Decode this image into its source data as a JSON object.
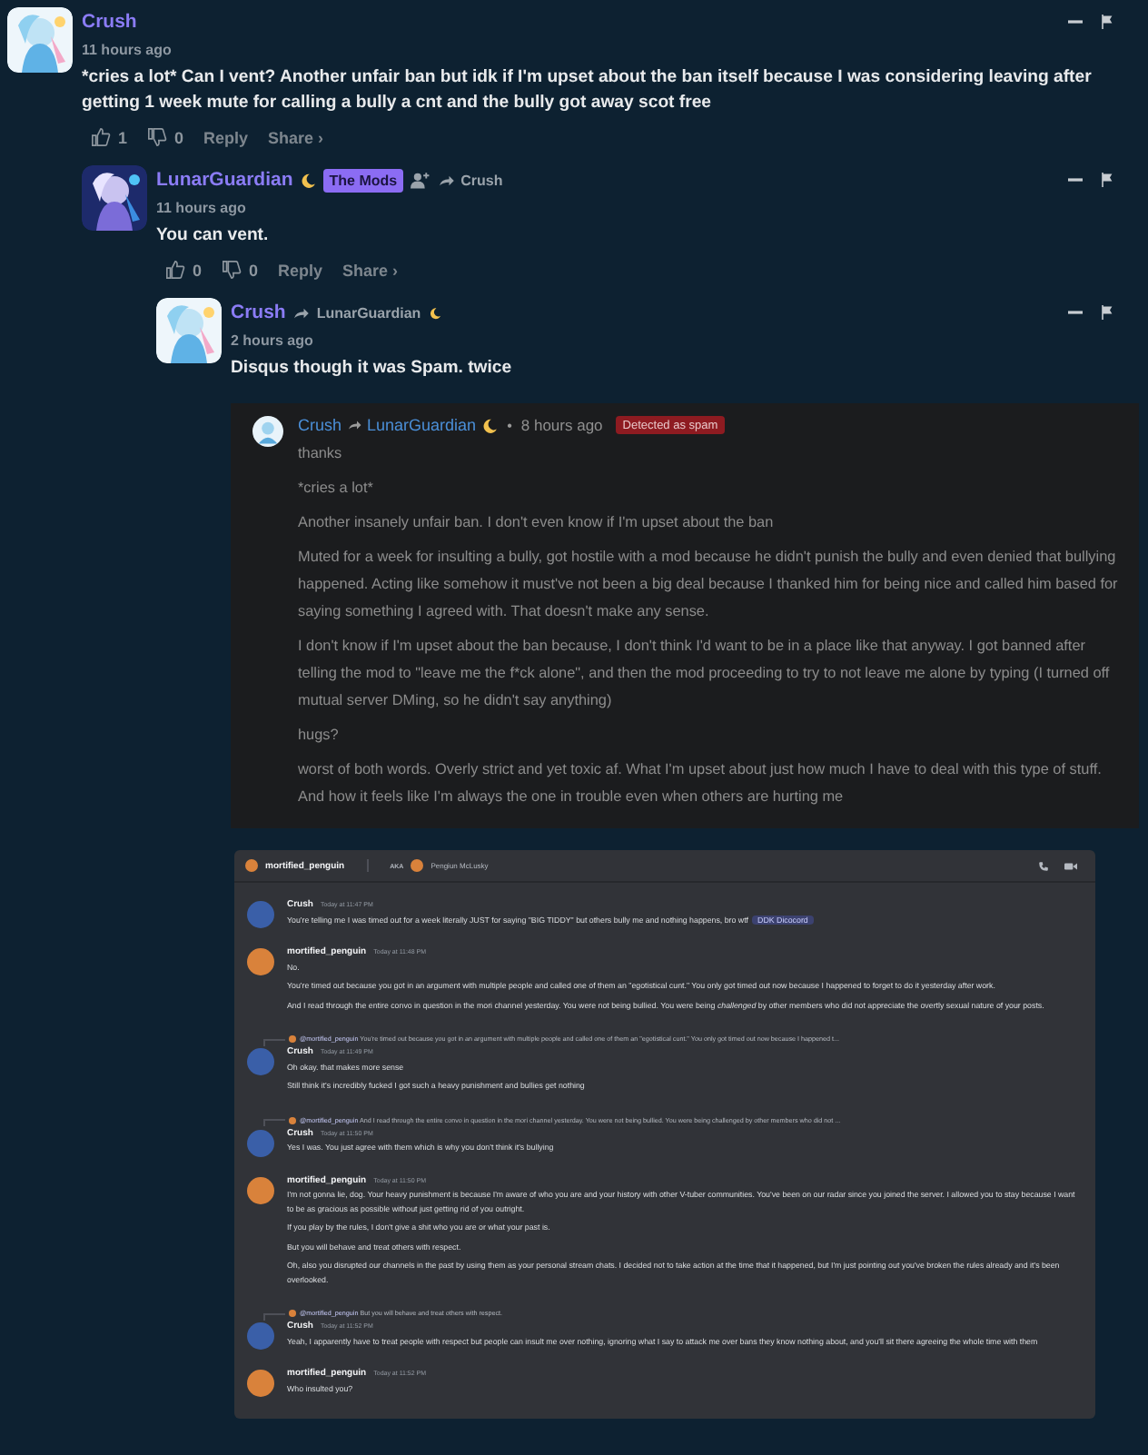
{
  "comments": [
    {
      "author": "Crush",
      "time": "11 hours ago",
      "text": "*cries a lot* Can I vent? Another unfair ban but idk if I'm upset about the ban itself because I was considering leaving after getting 1 week mute for calling a bully a cnt and the bully got away scot free",
      "likes": "1",
      "dislikes": "0",
      "actions": [
        "Reply",
        "Share ›"
      ],
      "children": [
        {
          "author": "LunarGuardian",
          "author_emoji": true,
          "badge": "The Mods",
          "follow_button": true,
          "reply_to": {
            "name": "Crush",
            "emoji": false
          },
          "time": "11 hours ago",
          "text": "You can vent.",
          "likes": "0",
          "dislikes": "0",
          "actions": [
            "Reply",
            "Share ›"
          ],
          "children": [
            {
              "author": "Crush",
              "reply_to": {
                "name": "LunarGuardian",
                "emoji": true
              },
              "time": "2 hours ago",
              "text": "Disqus though it was Spam. twice",
              "attachments": [
                {
                  "kind": "spam_comment",
                  "author": "Crush",
                  "reply_to": "LunarGuardian",
                  "separator": "•",
                  "time": "8 hours ago",
                  "badge": "Detected as spam",
                  "paragraphs": [
                    "thanks",
                    "*cries a lot*",
                    "Another insanely unfair ban. I don't even know if I'm upset about the ban",
                    "Muted for a week for insulting a bully, got hostile with a mod because he didn't punish the bully and even denied that bullying happened. Acting like somehow it must've not been a big deal because I thanked him for being nice and called him based for saying something I agreed with. That doesn't make any sense.",
                    "I don't know if I'm upset about the ban because, I don't think I'd want to be in a place like that anyway. I got banned after telling the mod to \"leave me the f*ck alone\", and then the mod proceeding to try to not leave me alone by typing (I turned off mutual server DMing, so he didn't say anything)",
                    "hugs?",
                    "worst of both words. Overly strict and yet toxic af. What I'm upset about just how much I have to deal with this type of stuff. And how it feels like I'm always the one in trouble even when others are hurting me"
                  ]
                },
                {
                  "kind": "chat",
                  "header": {
                    "name": "mortified_penguin",
                    "aka": "AKA",
                    "nickname": "Pengiun McLusky",
                    "color": "#d9823b"
                  },
                  "messages": [
                    {
                      "author": "Crush",
                      "color": "#3a5fa8",
                      "time": "Today at 11:47 PM",
                      "paragraphs": [
                        "You're telling me I was timed out for a week literally JUST for saying \"BIG TIDDY\" but others bully me and nothing happens, bro wtf"
                      ],
                      "tag": "DDK Dicocord"
                    },
                    {
                      "author": "mortified_penguin",
                      "color": "#d9823b",
                      "time": "Today at 11:48 PM",
                      "paragraphs": [
                        "No.",
                        "You're timed out because you got in an argument with multiple people and called one of them an \"egotistical cunt.\" You only got timed out now because I happened to forget to do it yesterday after work.",
                        "And I read through the entire convo in question in the mori channel yesterday. You were not being bullied. You were being *challenged* by other members who did not appreciate the overtly sexual nature of your posts."
                      ]
                    },
                    {
                      "author": "Crush",
                      "color": "#3a5fa8",
                      "time": "Today at 11:49 PM",
                      "reply": {
                        "mention": "@mortified_penguin",
                        "text": "You're timed out because you got in an argument with multiple people and called one of them an \"egotistical cunt.\" You only got timed out now because I happened t..."
                      },
                      "paragraphs": [
                        "Oh okay. that makes more sense",
                        "Still think it's incredibly fucked I got such a heavy punishment and bullies get nothing"
                      ]
                    },
                    {
                      "author": "Crush",
                      "color": "#3a5fa8",
                      "time": "Today at 11:50 PM",
                      "reply": {
                        "mention": "@mortified_penguin",
                        "text": "And I read through the entire convo in question in the mori channel yesterday. You were not being bullied. You were being challenged by other members who did not ..."
                      },
                      "paragraphs": [
                        "Yes I was. You just agree with them which is why you don't think it's bullying"
                      ]
                    },
                    {
                      "author": "mortified_penguin",
                      "color": "#d9823b",
                      "time": "Today at 11:50 PM",
                      "paragraphs": [
                        "I'm not gonna lie, dog. Your heavy punishment is because I'm aware of who you are and your history with other V-tuber communities. You've been on our radar since you joined the server. I allowed you to stay because I want to be as gracious as possible without just getting rid of you outright.",
                        "If you play by the rules, I don't give a shit who you are or what your past is.",
                        "But you will behave and treat others with respect.",
                        "Oh, also you disrupted our channels in the past by using them as your personal stream chats. I decided not to take action at the time that it happened, but I'm just pointing out you've broken the rules already and it's been overlooked."
                      ]
                    },
                    {
                      "author": "Crush",
                      "color": "#3a5fa8",
                      "time": "Today at 11:52 PM",
                      "reply": {
                        "mention": "@mortified_penguin",
                        "text": "But you will behave and treat others with respect."
                      },
                      "paragraphs": [
                        "Yeah, I apparently have to treat people with respect but people can insult me over nothing, ignoring what I say to attack me over bans they know nothing about, and you'll sit there agreeing the whole time with them"
                      ]
                    },
                    {
                      "author": "mortified_penguin",
                      "color": "#d9823b",
                      "time": "Today at 11:52 PM",
                      "paragraphs": [
                        "Who insulted you?"
                      ]
                    }
                  ]
                }
              ]
            }
          ]
        }
      ]
    }
  ]
}
